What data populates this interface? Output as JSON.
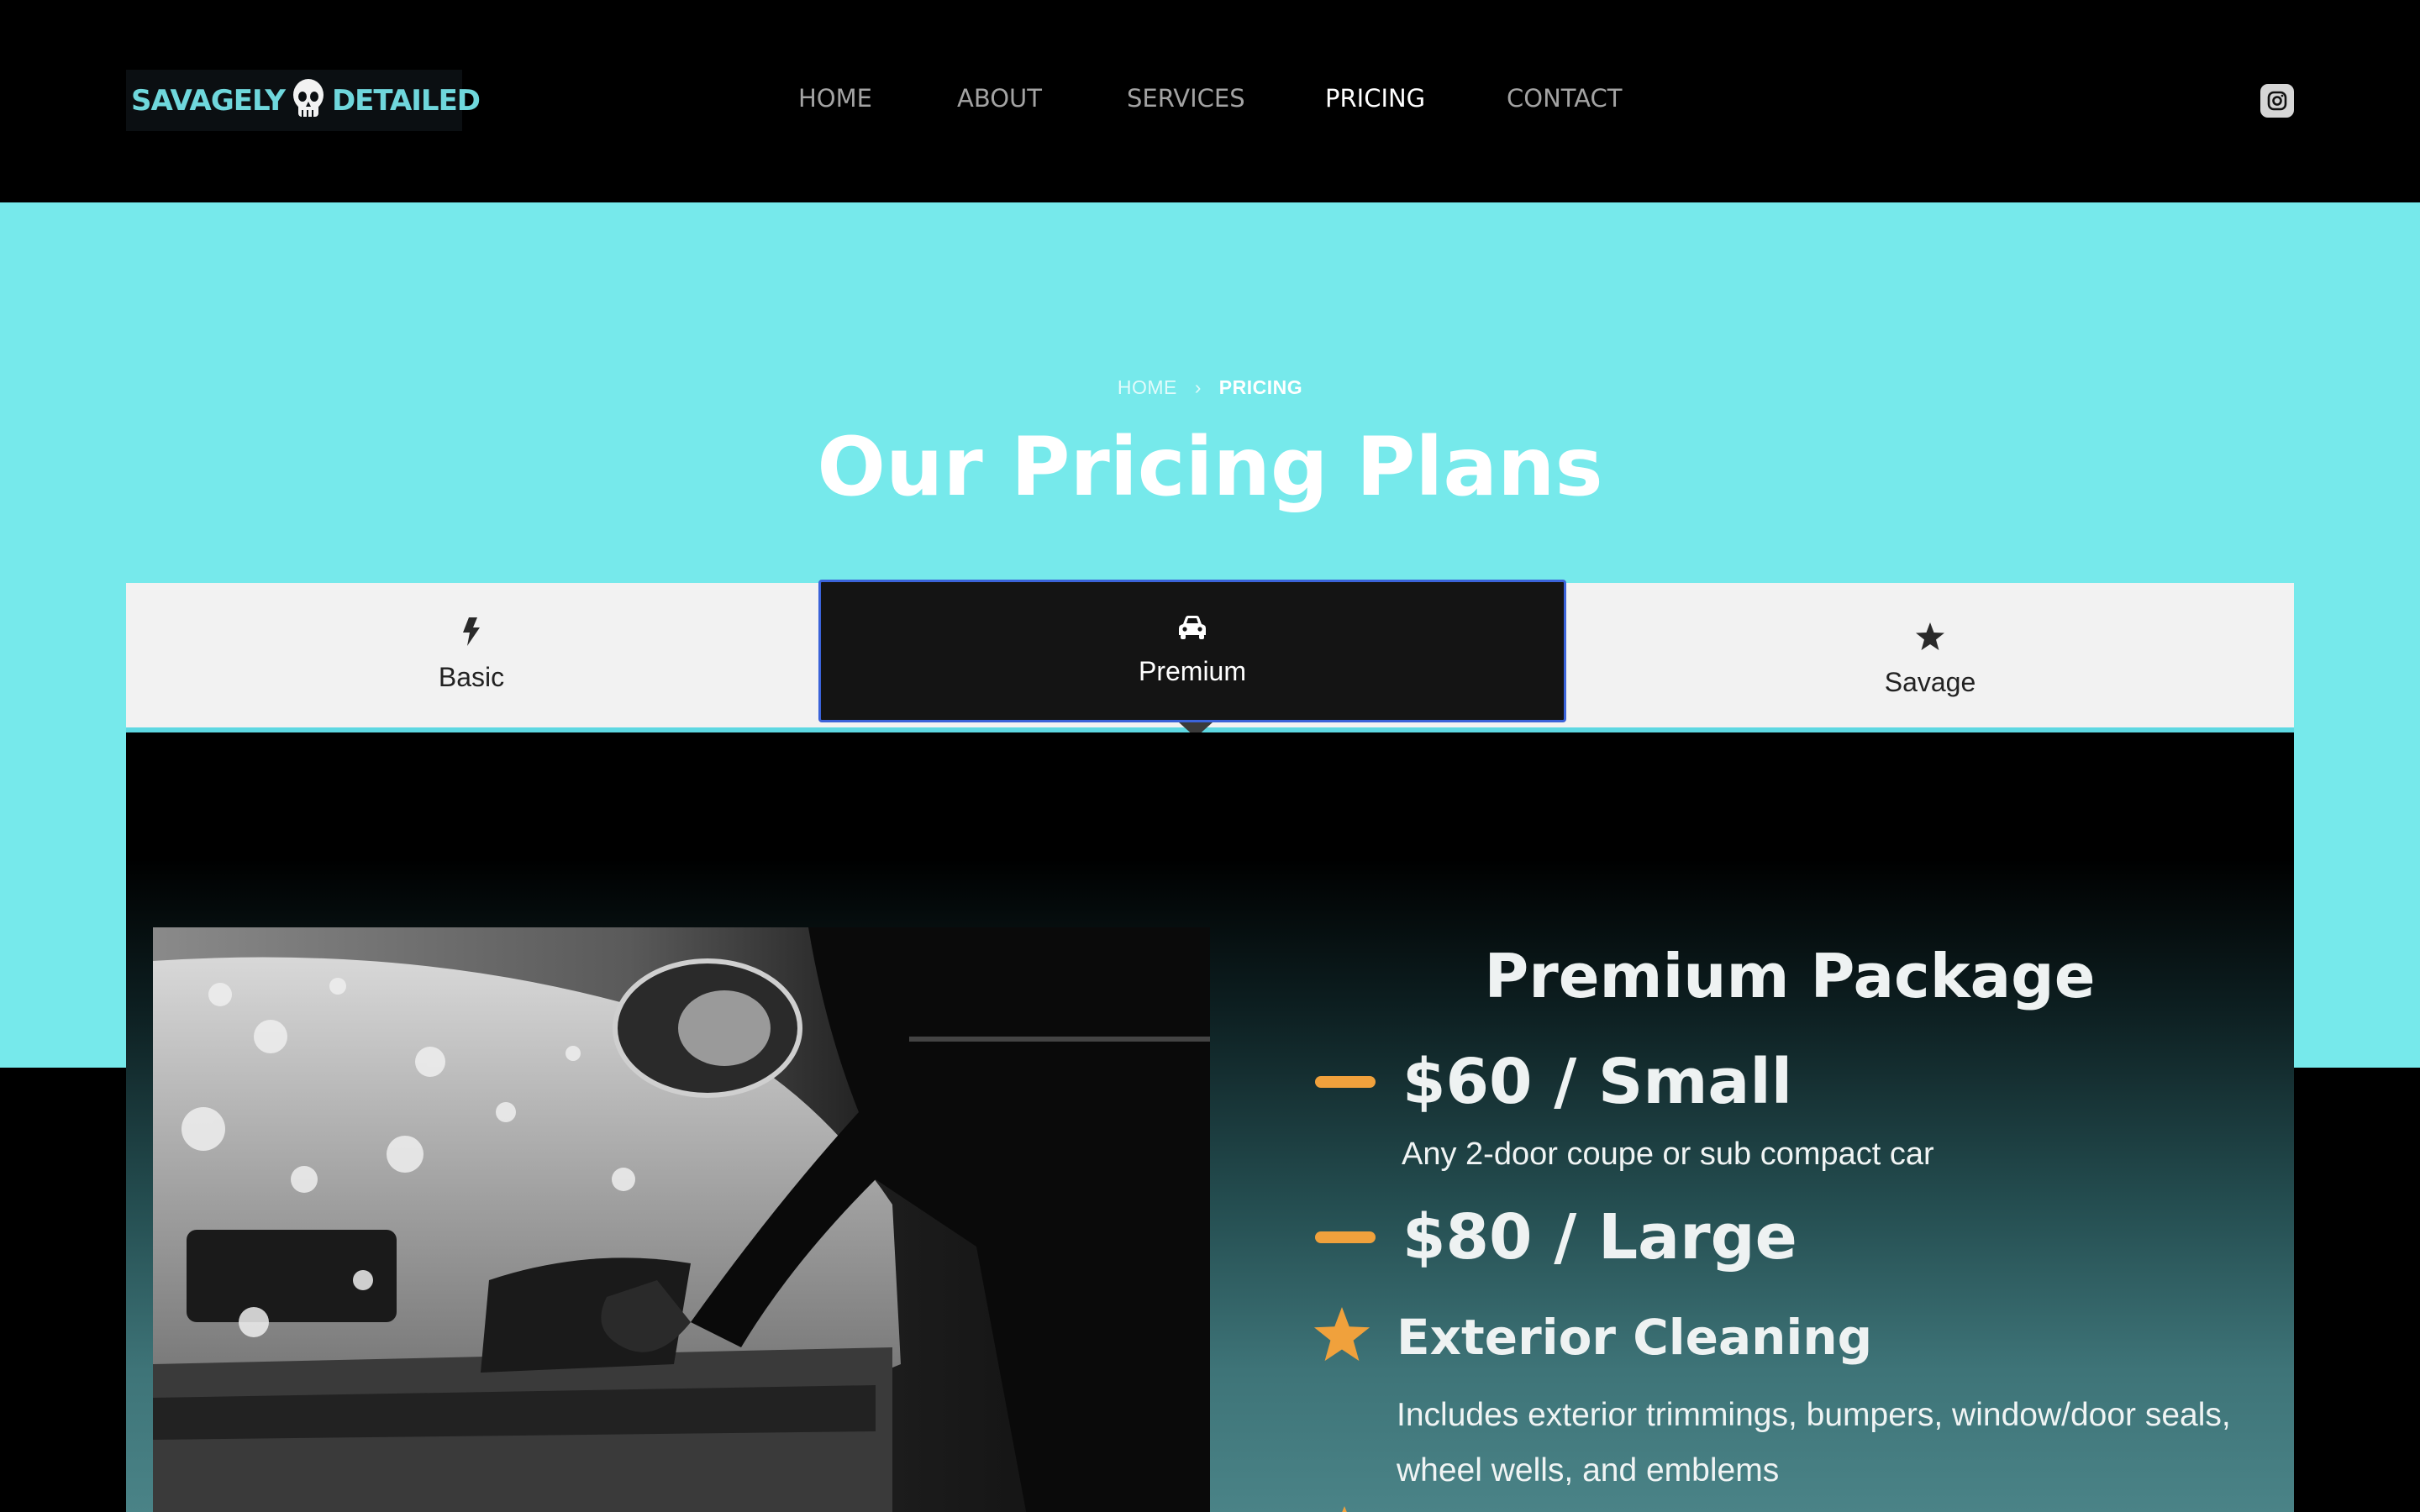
{
  "header": {
    "logo_text_left": "SAVAGELY",
    "logo_text_right": "DETAILED",
    "nav": [
      {
        "label": "HOME",
        "active": false
      },
      {
        "label": "ABOUT",
        "active": false
      },
      {
        "label": "SERVICES",
        "active": false
      },
      {
        "label": "PRICING",
        "active": true
      },
      {
        "label": "CONTACT",
        "active": false
      }
    ],
    "social_icon": "instagram-icon"
  },
  "hero": {
    "breadcrumb": {
      "home": "HOME",
      "current": "PRICING"
    },
    "title": "Our Pricing Plans",
    "background_color": "#76e9eb"
  },
  "tabs": [
    {
      "label": "Basic",
      "icon": "bolt-icon",
      "active": false
    },
    {
      "label": "Premium",
      "icon": "car-icon",
      "active": true
    },
    {
      "label": "Savage",
      "icon": "star-icon",
      "active": false
    }
  ],
  "package": {
    "title": "Premium Package",
    "prices": [
      {
        "label": "$60 / Small",
        "description": "Any 2-door coupe or sub compact car"
      },
      {
        "label": "$80 / Large",
        "description": ""
      }
    ],
    "features": [
      {
        "title": "Exterior Cleaning",
        "description": "Includes exterior trimmings, bumpers, window/door seals, wheel wells, and emblems"
      }
    ],
    "accent_color": "#f0a13c"
  }
}
